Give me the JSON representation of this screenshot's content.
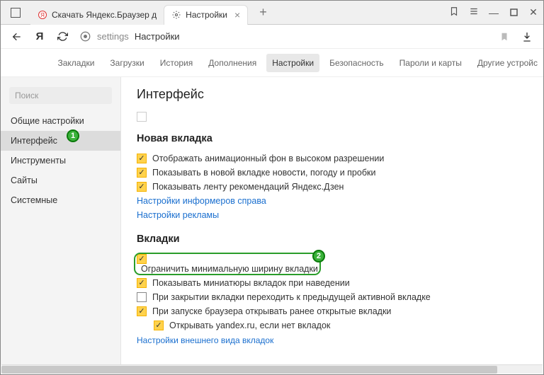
{
  "titlebar": {
    "tabs": [
      {
        "label": "Скачать Яндекс.Браузер д",
        "active": false
      },
      {
        "label": "Настройки",
        "active": true
      }
    ],
    "newtab": "+"
  },
  "toolbar": {
    "addr_text": "settings",
    "addr_title": "Настройки"
  },
  "navrow": {
    "items": [
      "Закладки",
      "Загрузки",
      "История",
      "Дополнения",
      "Настройки",
      "Безопасность",
      "Пароли и карты",
      "Другие устройс"
    ],
    "active": "Настройки"
  },
  "sidebar": {
    "search": "Поиск",
    "items": [
      "Общие настройки",
      "Интерфейс",
      "Инструменты",
      "Сайты",
      "Системные"
    ],
    "active": "Интерфейс"
  },
  "main": {
    "heading": "Интерфейс",
    "section_newtab": {
      "title": "Новая вкладка",
      "rows": [
        {
          "checked": true,
          "label": "Отображать анимационный фон в высоком разрешении"
        },
        {
          "checked": true,
          "label": "Показывать в новой вкладке новости, погоду и пробки"
        },
        {
          "checked": true,
          "label": "Показывать ленту рекомендаций Яндекс.Дзен"
        }
      ],
      "links": [
        "Настройки информеров справа",
        "Настройки рекламы"
      ]
    },
    "section_tabs": {
      "title": "Вкладки",
      "rows": [
        {
          "checked": true,
          "label": "Ограничить минимальную ширину вкладки",
          "highlight": true
        },
        {
          "checked": true,
          "label": "Показывать миниатюры вкладок при наведении"
        },
        {
          "checked": false,
          "label": "При закрытии вкладки переходить к предыдущей активной вкладке"
        },
        {
          "checked": true,
          "label": "При запуске браузера открывать ранее открытые вкладки"
        },
        {
          "checked": true,
          "label": "Открывать yandex.ru, если нет вкладок",
          "indent": true
        }
      ],
      "cutoff": "Настройки внешнего вида вкладок"
    }
  },
  "badges": {
    "b1": "1",
    "b2": "2"
  }
}
